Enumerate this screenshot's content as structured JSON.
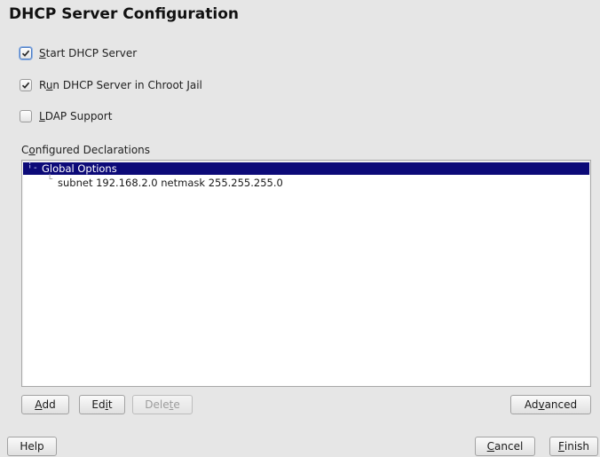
{
  "window": {
    "title": "DHCP Server Configuration"
  },
  "options": {
    "start_server": {
      "pre": "",
      "mnemonic": "S",
      "post": "tart DHCP Server",
      "checked": true
    },
    "chroot_jail": {
      "pre": "R",
      "mnemonic": "u",
      "post": "n DHCP Server in Chroot Jail",
      "checked": true
    },
    "ldap_support": {
      "pre": "",
      "mnemonic": "L",
      "post": "DAP Support",
      "checked": false
    }
  },
  "declarations": {
    "label_pre": "C",
    "label_mnemonic": "o",
    "label_post": "nfigured Declarations",
    "items": [
      {
        "label": "Global Options",
        "selected": true
      },
      {
        "label": "subnet 192.168.2.0 netmask 255.255.255.0",
        "selected": false
      }
    ]
  },
  "buttons": {
    "add": {
      "pre": "",
      "mnemonic": "A",
      "post": "dd"
    },
    "edit": {
      "pre": "Ed",
      "mnemonic": "i",
      "post": "t"
    },
    "delete": {
      "pre": "Dele",
      "mnemonic": "t",
      "post": "e",
      "enabled": false
    },
    "advanced": {
      "pre": "Ad",
      "mnemonic": "v",
      "post": "anced"
    },
    "help": {
      "pre": "Help",
      "mnemonic": "",
      "post": ""
    },
    "cancel": {
      "pre": "",
      "mnemonic": "C",
      "post": "ancel"
    },
    "finish": {
      "pre": "",
      "mnemonic": "F",
      "post": "inish"
    }
  },
  "colors": {
    "selection": "#0c0a78",
    "background": "#e6e6e6",
    "check": "#2b2b2b"
  }
}
